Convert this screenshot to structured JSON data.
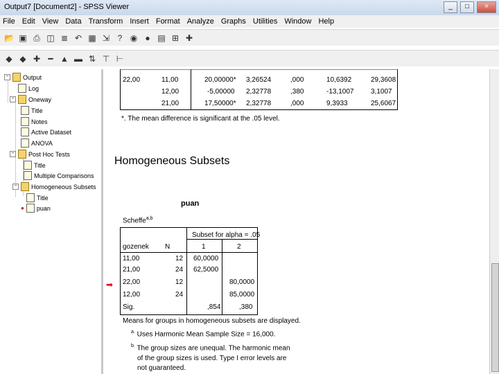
{
  "window": {
    "title": "Output7 [Document2] - SPSS Viewer",
    "min": "_",
    "max": "□",
    "close": "×"
  },
  "menu": [
    "File",
    "Edit",
    "View",
    "Data",
    "Transform",
    "Insert",
    "Format",
    "Analyze",
    "Graphs",
    "Utilities",
    "Window",
    "Help"
  ],
  "tree": {
    "items": [
      {
        "label": "Output"
      },
      {
        "label": "Log"
      },
      {
        "label": "Oneway"
      },
      {
        "label": "Title"
      },
      {
        "label": "Notes"
      },
      {
        "label": "Active Dataset"
      },
      {
        "label": "ANOVA"
      },
      {
        "label": "Post Hoc Tests"
      },
      {
        "label": "Title"
      },
      {
        "label": "Multiple Comparisons"
      },
      {
        "label": "Homogeneous Subsets"
      },
      {
        "label": "Title"
      },
      {
        "label": "puan"
      }
    ]
  },
  "mc_rows": [
    {
      "g": "22,00",
      "c": "11,00",
      "d": "20,00000*",
      "se": "3,26524",
      "sig": ",000",
      "lo": "10,6392",
      "hi": "29,3608"
    },
    {
      "g": "",
      "c": "12,00",
      "d": "-5,00000",
      "se": "2,32778",
      "sig": ",380",
      "lo": "-13,1007",
      "hi": "3,1007"
    },
    {
      "g": "",
      "c": "21,00",
      "d": "17,50000*",
      "se": "2,32778",
      "sig": ",000",
      "lo": "9,3933",
      "hi": "25,6067"
    }
  ],
  "mc_footnote": "*. The mean difference is significant at the .05 level.",
  "heading": "Homogeneous Subsets",
  "subset": {
    "title": "puan",
    "method": "Scheffe",
    "method_sup": "a,b",
    "subset_header": "Subset for alpha = .05",
    "col_group": "gozenek",
    "col_n": "N",
    "col_1": "1",
    "col_2": "2",
    "rows": [
      {
        "g": "11,00",
        "n": "12",
        "s1": "60,0000",
        "s2": ""
      },
      {
        "g": "21,00",
        "n": "24",
        "s1": "62,5000",
        "s2": ""
      },
      {
        "g": "22,00",
        "n": "12",
        "s1": "",
        "s2": "80,0000"
      },
      {
        "g": "12,00",
        "n": "24",
        "s1": "",
        "s2": "85,0000"
      },
      {
        "g": "Sig.",
        "n": "",
        "s1": ",854",
        "s2": ",380"
      }
    ],
    "note_main": "Means for groups in homogeneous subsets are displayed.",
    "note_a": "Uses Harmonic Mean Sample Size = 16,000.",
    "note_b_1": "The group sizes are unequal. The harmonic mean",
    "note_b_2": "of the group sizes is used. Type I error levels are",
    "note_b_3": "not guaranteed.",
    "note_a_mark": "a.",
    "note_b_mark": "b."
  },
  "colors": {
    "arrow": "#e0101a"
  }
}
